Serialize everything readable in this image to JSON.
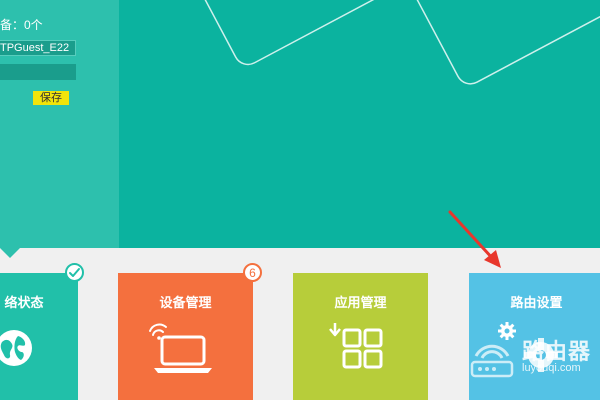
{
  "guest_panel": {
    "devices_text": "备：0个",
    "ssid_value": "TPGuest_E22",
    "password_value": "",
    "save_label": "保存"
  },
  "tiles": {
    "network_status": {
      "label": "络状态",
      "icon": "globe-icon",
      "badge_icon": "check-icon"
    },
    "device_management": {
      "label": "设备管理",
      "icon": "laptop-wifi-icon",
      "badge_count": "6"
    },
    "app_management": {
      "label": "应用管理",
      "icon": "apps-grid-icon"
    },
    "router_settings": {
      "label": "路由设置",
      "icon": "router-gear-icon"
    }
  },
  "watermark": {
    "cn": "路由器",
    "en": "luyouqi.com"
  },
  "colors": {
    "hero_bg": "#0bb39f",
    "guest_panel_bg": "#2dc0ad",
    "network_tile": "#21c0a9",
    "device_tile": "#f4703e",
    "app_tile": "#b7cd3a",
    "router_tile": "#54c2e5",
    "save_button": "#f2e40a",
    "arrow": "#e8372c"
  }
}
